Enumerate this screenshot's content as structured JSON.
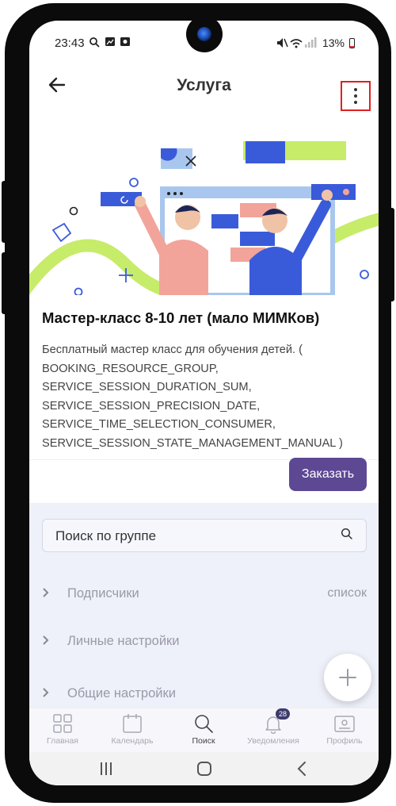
{
  "status_bar": {
    "time": "23:43",
    "battery": "13%"
  },
  "header": {
    "title": "Услуга"
  },
  "service": {
    "title": "Мастер-класс 8-10 лет (мало МИМКов)",
    "description": "Бесплатный мастер класс для обучения детей. (\nBOOKING_RESOURCE_GROUP,\nSERVICE_SESSION_DURATION_SUM,\nSERVICE_SESSION_PRECISION_DATE,\nSERVICE_TIME_SELECTION_CONSUMER,\nSERVICE_SESSION_STATE_MANAGEMENT_MANUAL )",
    "order_label": "Заказать"
  },
  "group_panel": {
    "search_placeholder": "Поиск по группе",
    "rows": [
      {
        "label": "Подписчики",
        "extra": "список"
      },
      {
        "label": "Личные настройки",
        "extra": ""
      },
      {
        "label": "Общие настройки",
        "extra": ""
      }
    ]
  },
  "bottom_nav": {
    "items": [
      {
        "label": "Главная",
        "icon": "grid-icon"
      },
      {
        "label": "Календарь",
        "icon": "calendar-icon"
      },
      {
        "label": "Поиск",
        "icon": "search-icon"
      },
      {
        "label": "Уведомления",
        "icon": "bell-icon",
        "badge": "28"
      },
      {
        "label": "Профиль",
        "icon": "profile-icon"
      }
    ],
    "active": "Поиск"
  },
  "colors": {
    "accent": "#5d4894",
    "panel_bg": "#eef0fa",
    "highlight_border": "#e02020"
  }
}
